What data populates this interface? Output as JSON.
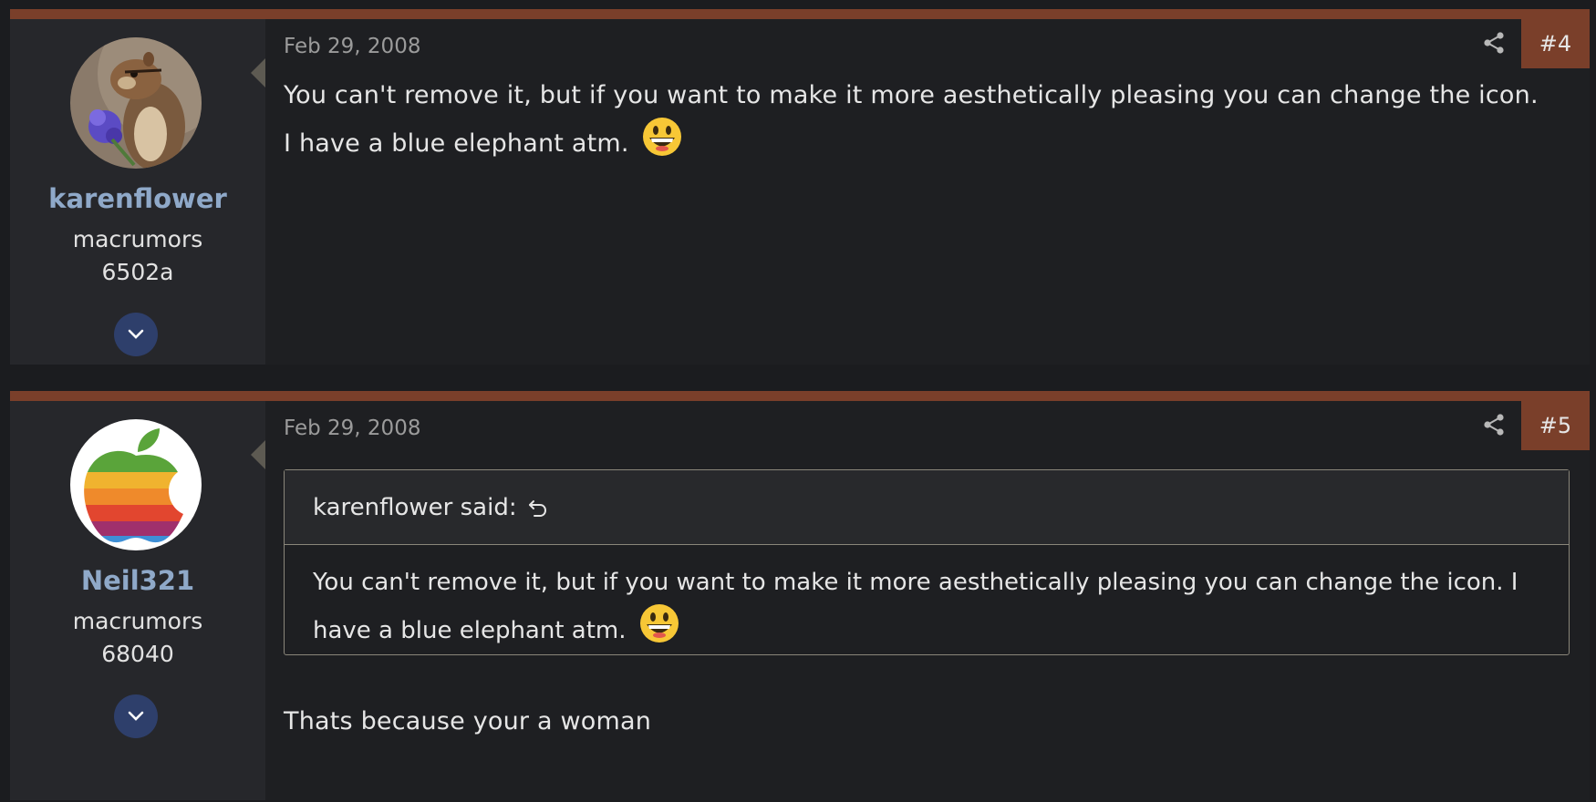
{
  "posts": [
    {
      "number": "#4",
      "date": "Feb 29, 2008",
      "author": {
        "name": "karenflower",
        "title_line1": "macrumors",
        "title_line2": "6502a"
      },
      "body": "You can't remove it, but if you want to make it more aesthetically pleasing you can change the icon. I have a blue elephant atm.",
      "emoji": "grinning-face"
    },
    {
      "number": "#5",
      "date": "Feb 29, 2008",
      "author": {
        "name": "Neil321",
        "title_line1": "macrumors",
        "title_line2": "68040"
      },
      "quote": {
        "header": "karenflower said:",
        "body": "You can't remove it, but if you want to make it more aesthetically pleasing you can change the icon. I have a blue elephant atm.",
        "emoji": "grinning-face"
      },
      "body": "Thats because your a woman"
    }
  ],
  "colors": {
    "accent": "#7a3f2a",
    "username": "#8fa9c9",
    "expand_button": "#2e3f6b"
  }
}
